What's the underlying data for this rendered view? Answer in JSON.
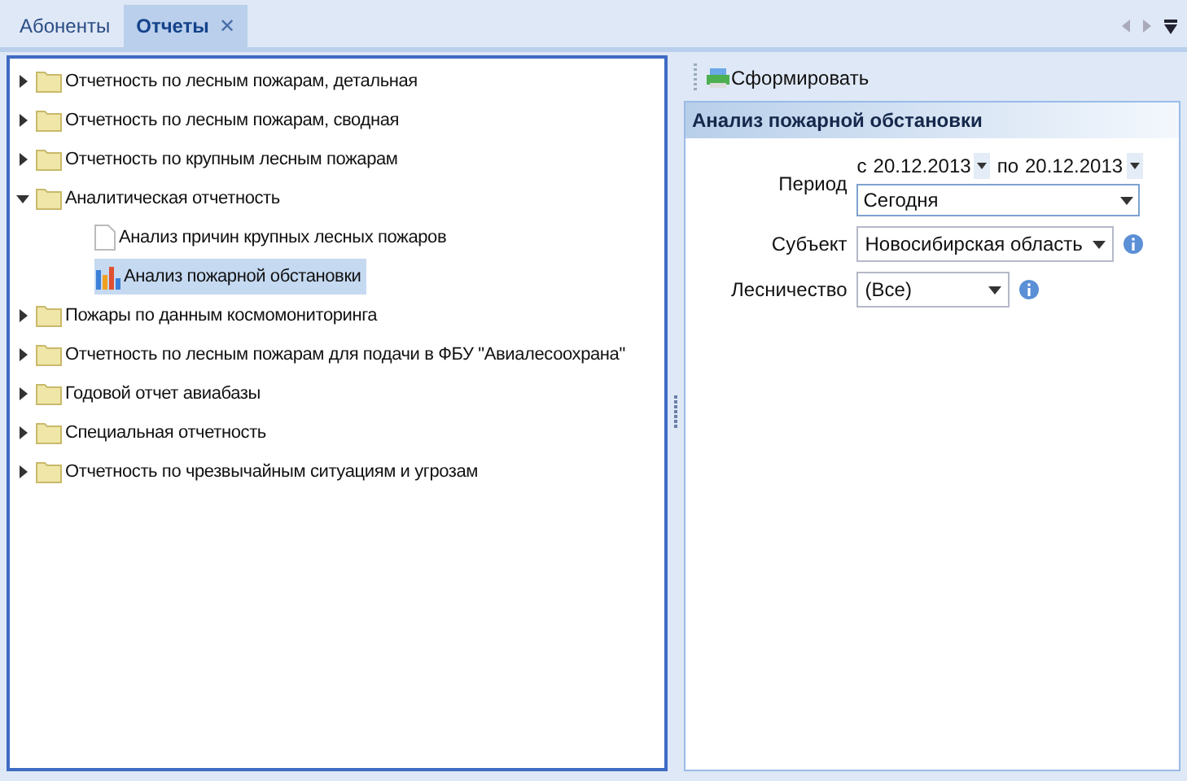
{
  "tabs": [
    {
      "label": "Абоненты",
      "selected": false,
      "closable": false
    },
    {
      "label": "Отчеты",
      "selected": true,
      "closable": true
    }
  ],
  "close_glyph": "✕",
  "tree": [
    {
      "label": "Отчетность по лесным пожарам, детальная",
      "kind": "folder",
      "expanded": false,
      "selected": false
    },
    {
      "label": "Отчетность по лесным пожарам, сводная",
      "kind": "folder",
      "expanded": false,
      "selected": false
    },
    {
      "label": "Отчетность по крупным лесным пожарам",
      "kind": "folder",
      "expanded": false,
      "selected": false
    },
    {
      "label": "Аналитическая отчетность",
      "kind": "folder",
      "expanded": true,
      "selected": false,
      "children": [
        {
          "label": "Анализ причин крупных лесных пожаров",
          "kind": "document",
          "selected": false
        },
        {
          "label": "Анализ пожарной обстановки",
          "kind": "chart",
          "selected": true
        }
      ]
    },
    {
      "label": "Пожары по данным космомониторинга",
      "kind": "folder",
      "expanded": false,
      "selected": false
    },
    {
      "label": "Отчетность по лесным пожарам для подачи в ФБУ \"Авиалесоохрана\"",
      "kind": "folder",
      "expanded": false,
      "selected": false
    },
    {
      "label": "Годовой отчет авиабазы",
      "kind": "folder",
      "expanded": false,
      "selected": false
    },
    {
      "label": "Специальная отчетность",
      "kind": "folder",
      "expanded": false,
      "selected": false
    },
    {
      "label": "Отчетность по чрезвычайным ситуациям и угрозам",
      "kind": "folder",
      "expanded": false,
      "selected": false
    }
  ],
  "toolbar": {
    "button": "Сформировать"
  },
  "form": {
    "title": "Анализ пожарной обстановки",
    "period": {
      "label": "Период",
      "from_prefix": "с",
      "from": "20.12.2013",
      "to_prefix": "по",
      "to": "20.12.2013",
      "preset": "Сегодня"
    },
    "subject": {
      "label": "Субъект",
      "value": "Новосибирская область"
    },
    "forestry": {
      "label": "Лесничество",
      "value": "(Все)"
    }
  }
}
